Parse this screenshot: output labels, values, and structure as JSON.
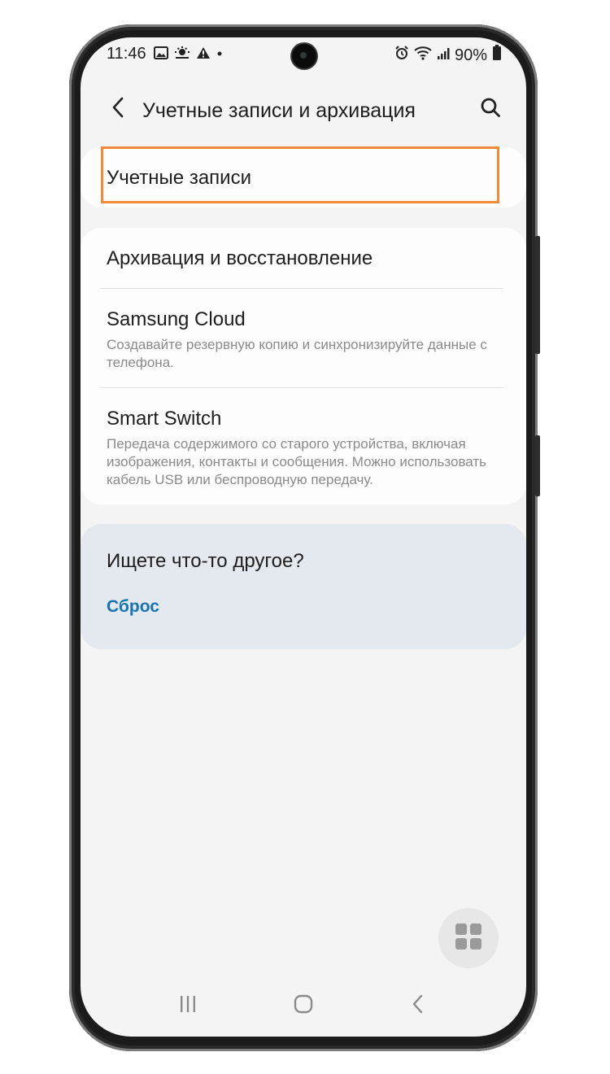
{
  "status_bar": {
    "time": "11:46",
    "battery_percent": "90%",
    "left_icons": [
      "gallery-icon",
      "weather-icon",
      "warning-icon",
      "dot-icon"
    ],
    "right_icons": [
      "alarm-icon",
      "wifi-icon",
      "signal-icon",
      "battery-icon"
    ]
  },
  "header": {
    "title": "Учетные записи и архивация",
    "back_icon": "chevron-left-icon",
    "search_icon": "search-icon"
  },
  "accounts_card": {
    "title": "Учетные записи",
    "highlight_color": "#ef8a3a"
  },
  "backup_card": {
    "items": [
      {
        "title": "Архивация и восстановление",
        "subtitle": ""
      },
      {
        "title": "Samsung Cloud",
        "subtitle": "Создавайте резервную копию и синхронизируйте данные с телефона."
      },
      {
        "title": "Smart Switch",
        "subtitle": "Передача содержимого со старого устройства, включая изображения, контакты и сообщения. Можно использовать кабель USB или беспроводную передачу."
      }
    ]
  },
  "other_card": {
    "title": "Ищете что-то другое?",
    "link": "Сброс",
    "link_color": "#1a73b0"
  },
  "fab": {
    "icon": "apps-grid-icon"
  },
  "navbar": {
    "recent_icon": "recent-apps-icon",
    "home_icon": "home-icon",
    "back_icon": "back-nav-icon"
  }
}
